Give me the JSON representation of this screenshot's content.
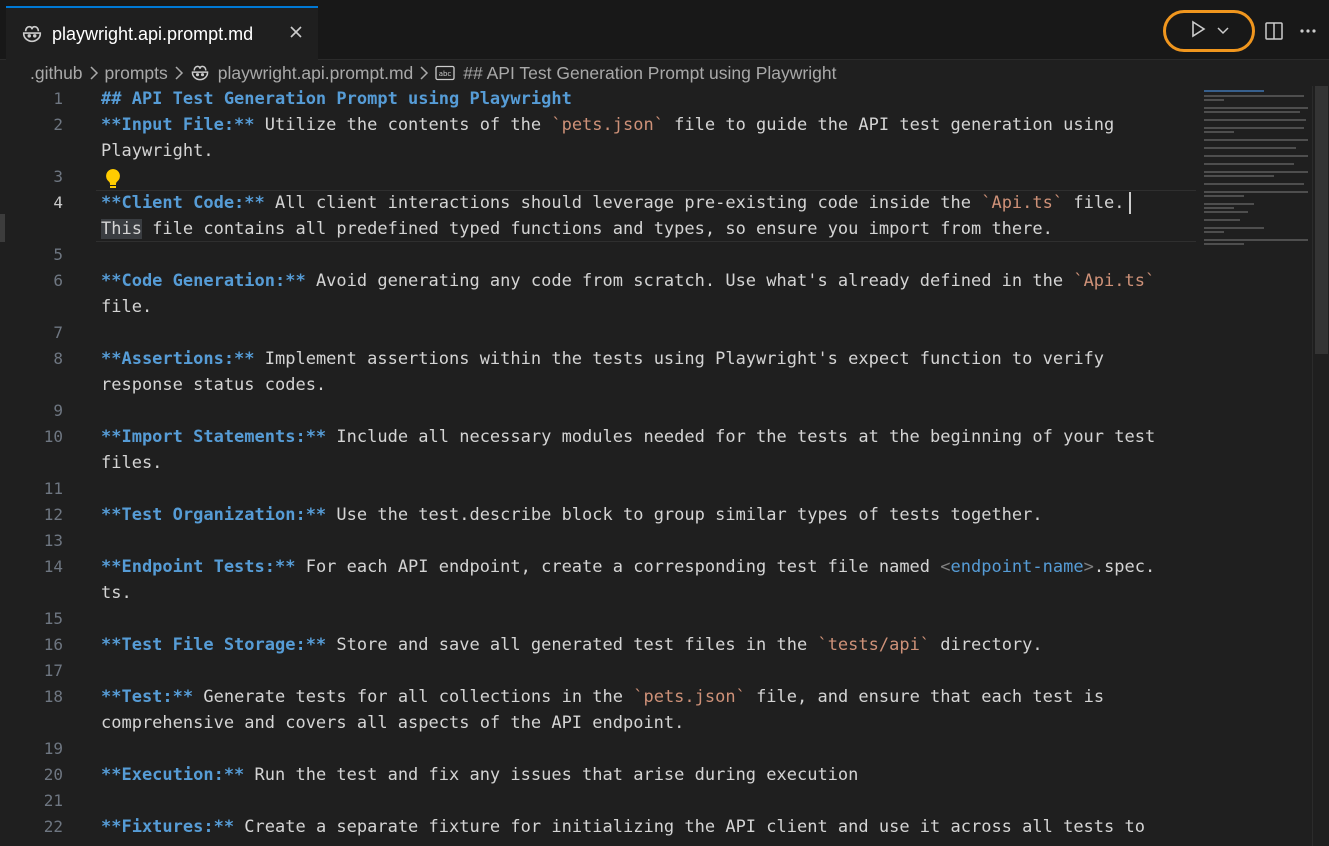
{
  "tab": {
    "label": "playwright.api.prompt.md",
    "close": "×"
  },
  "breadcrumb": {
    "items": [
      ".github",
      "prompts",
      "playwright.api.prompt.md",
      "## API Test Generation Prompt using Playwright"
    ]
  },
  "lines": [
    {
      "n": "1"
    },
    {
      "n": "2"
    },
    {
      "n": "3"
    },
    {
      "n": "4"
    },
    {
      "n": "5"
    },
    {
      "n": "6"
    },
    {
      "n": "7"
    },
    {
      "n": "8"
    },
    {
      "n": "9"
    },
    {
      "n": "10"
    },
    {
      "n": "11"
    },
    {
      "n": "12"
    },
    {
      "n": "13"
    },
    {
      "n": "14"
    },
    {
      "n": "15"
    },
    {
      "n": "16"
    },
    {
      "n": "17"
    },
    {
      "n": "18"
    },
    {
      "n": "19"
    },
    {
      "n": "20"
    },
    {
      "n": "21"
    },
    {
      "n": "22"
    }
  ],
  "code": {
    "l1": "## API Test Generation Prompt using Playwright",
    "l2_bold": "**Input File:**",
    "l2_a": " Utilize the contents of the ",
    "l2_code": "`pets.json`",
    "l2_b": " file to guide the API test generation using",
    "l2_wrap": "Playwright.",
    "l4_bold": "**Client Code:**",
    "l4_a": " All client interactions should leverage pre-existing code inside the ",
    "l4_code": "`Api.ts`",
    "l4_b": " file.",
    "l4_wrap_hl": "This",
    "l4_wrap": " file contains all predefined typed functions and types, so ensure you import from there.",
    "l6_bold": "**Code Generation:**",
    "l6_a": " Avoid generating any code from scratch. Use what's already defined in the ",
    "l6_code": "`Api.ts`",
    "l6_wrap": "file.",
    "l8_bold": "**Assertions:**",
    "l8_a": " Implement assertions within the tests using Playwright's expect function to verify",
    "l8_wrap": "response status codes.",
    "l10_bold": "**Import Statements:**",
    "l10_a": " Include all necessary modules needed for the tests at the beginning of your test",
    "l10_wrap": "files.",
    "l12_bold": "**Test Organization:**",
    "l12_a": " Use the test.describe block to group similar types of tests together.",
    "l14_bold": "**Endpoint Tests:**",
    "l14_a": " For each API endpoint, create a corresponding test file named ",
    "l14_lt": "<",
    "l14_tag": "endpoint-name",
    "l14_gt": ">",
    "l14_b": ".spec.",
    "l14_wrap": "ts.",
    "l16_bold": "**Test File Storage:**",
    "l16_a": " Store and save all generated test files in the ",
    "l16_code": "`tests/api`",
    "l16_b": " directory.",
    "l18_bold": "**Test:**",
    "l18_a": " Generate tests for all collections in the ",
    "l18_code": "`pets.json`",
    "l18_b": " file, and ensure that each test is",
    "l18_wrap": "comprehensive and covers all aspects of the API endpoint.",
    "l20_bold": "**Execution:**",
    "l20_a": " Run the test and fix any issues that arise during execution",
    "l22_bold": "**Fixtures:**",
    "l22_a": " Create a separate fixture for initializing the API client and use it across all tests to"
  },
  "colors": {
    "accent": "#0078d4",
    "run_highlight": "#f0961e",
    "heading": "#569cd6",
    "inline_code": "#ce9178"
  },
  "icons": [
    "copilot-icon",
    "close-icon",
    "run-icon",
    "chevron-down-icon",
    "split-editor-icon",
    "more-icon",
    "chevron-right-icon",
    "symbol-string-icon",
    "lightbulb-icon"
  ]
}
